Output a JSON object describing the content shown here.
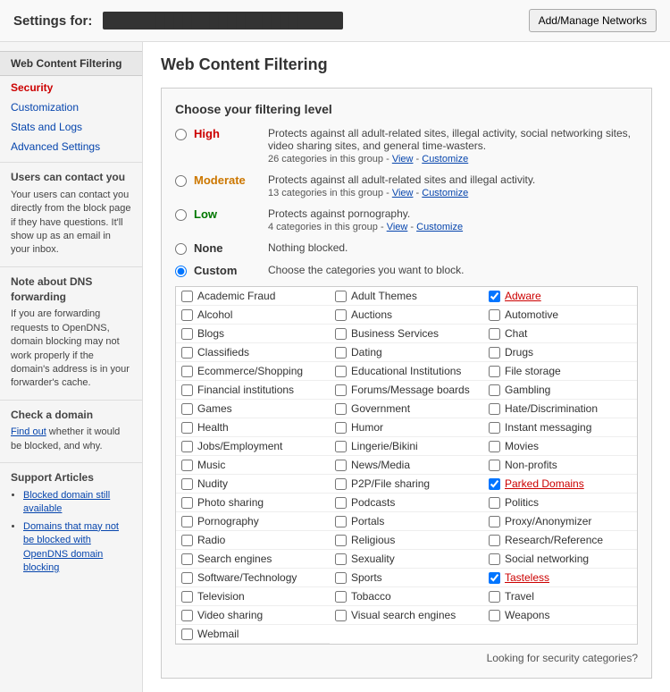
{
  "header": {
    "title": "Settings for:",
    "account": "█████████████████",
    "add_networks_btn": "Add/Manage Networks"
  },
  "sidebar": {
    "section_title": "Web Content Filtering",
    "links": [
      {
        "label": "Security",
        "active": false
      },
      {
        "label": "Customization",
        "active": false
      },
      {
        "label": "Stats and Logs",
        "active": false
      },
      {
        "label": "Advanced Settings",
        "active": false
      }
    ],
    "contact_title": "Users can contact you",
    "contact_text": "Your users can contact you directly from the block page if they have questions. It'll show up as an email in your inbox.",
    "dns_title": "Note about DNS forwarding",
    "dns_text": "If you are forwarding requests to OpenDNS, domain blocking may not work properly if the domain's address is in your forwarder's cache.",
    "check_title": "Check a domain",
    "check_link_text": "Find out",
    "check_text": " whether it would be blocked, and why.",
    "support_title": "Support Articles",
    "support_links": [
      "Blocked domain still available",
      "Domains that may not be blocked with OpenDNS domain blocking"
    ]
  },
  "content": {
    "title": "Web Content Filtering",
    "filter_panel_title": "Choose your filtering level",
    "options": [
      {
        "id": "high",
        "label": "High",
        "color_class": "high",
        "desc": "Protects against all adult-related sites, illegal activity, social networking sites, video sharing sites, and general time-wasters.",
        "sub": "26 categories in this group - View - Customize",
        "checked": false
      },
      {
        "id": "moderate",
        "label": "Moderate",
        "color_class": "moderate",
        "desc": "Protects against all adult-related sites and illegal activity.",
        "sub": "13 categories in this group - View - Customize",
        "checked": false
      },
      {
        "id": "low",
        "label": "Low",
        "color_class": "low",
        "desc": "Protects against pornography.",
        "sub": "4 categories in this group - View - Customize",
        "checked": false
      },
      {
        "id": "none",
        "label": "None",
        "color_class": "",
        "desc": "Nothing blocked.",
        "sub": "",
        "checked": false
      },
      {
        "id": "custom",
        "label": "Custom",
        "color_class": "",
        "desc": "Choose the categories you want to block.",
        "sub": "",
        "checked": true
      }
    ],
    "categories": [
      {
        "label": "Academic Fraud",
        "checked": false,
        "col": 0
      },
      {
        "label": "Adult Themes",
        "checked": false,
        "col": 1
      },
      {
        "label": "Adware",
        "checked": true,
        "col": 2
      },
      {
        "label": "Alcohol",
        "checked": false,
        "col": 0
      },
      {
        "label": "Auctions",
        "checked": false,
        "col": 1
      },
      {
        "label": "Automotive",
        "checked": false,
        "col": 2
      },
      {
        "label": "Blogs",
        "checked": false,
        "col": 0
      },
      {
        "label": "Business Services",
        "checked": false,
        "col": 1
      },
      {
        "label": "Chat",
        "checked": false,
        "col": 2
      },
      {
        "label": "Classifieds",
        "checked": false,
        "col": 0
      },
      {
        "label": "Dating",
        "checked": false,
        "col": 1
      },
      {
        "label": "Drugs",
        "checked": false,
        "col": 2
      },
      {
        "label": "Ecommerce/Shopping",
        "checked": false,
        "col": 0
      },
      {
        "label": "Educational Institutions",
        "checked": false,
        "col": 1
      },
      {
        "label": "File storage",
        "checked": false,
        "col": 2
      },
      {
        "label": "Financial institutions",
        "checked": false,
        "col": 0
      },
      {
        "label": "Forums/Message boards",
        "checked": false,
        "col": 1
      },
      {
        "label": "Gambling",
        "checked": false,
        "col": 2
      },
      {
        "label": "Games",
        "checked": false,
        "col": 0
      },
      {
        "label": "Government",
        "checked": false,
        "col": 1
      },
      {
        "label": "Hate/Discrimination",
        "checked": false,
        "col": 2
      },
      {
        "label": "Health",
        "checked": false,
        "col": 0
      },
      {
        "label": "Humor",
        "checked": false,
        "col": 1
      },
      {
        "label": "Instant messaging",
        "checked": false,
        "col": 2
      },
      {
        "label": "Jobs/Employment",
        "checked": false,
        "col": 0
      },
      {
        "label": "Lingerie/Bikini",
        "checked": false,
        "col": 1
      },
      {
        "label": "Movies",
        "checked": false,
        "col": 2
      },
      {
        "label": "Music",
        "checked": false,
        "col": 0
      },
      {
        "label": "News/Media",
        "checked": false,
        "col": 1
      },
      {
        "label": "Non-profits",
        "checked": false,
        "col": 2
      },
      {
        "label": "Nudity",
        "checked": false,
        "col": 0
      },
      {
        "label": "P2P/File sharing",
        "checked": false,
        "col": 1
      },
      {
        "label": "Parked Domains",
        "checked": true,
        "col": 2
      },
      {
        "label": "Photo sharing",
        "checked": false,
        "col": 0
      },
      {
        "label": "Podcasts",
        "checked": false,
        "col": 1
      },
      {
        "label": "Politics",
        "checked": false,
        "col": 2
      },
      {
        "label": "Pornography",
        "checked": false,
        "col": 0
      },
      {
        "label": "Portals",
        "checked": false,
        "col": 1
      },
      {
        "label": "Proxy/Anonymizer",
        "checked": false,
        "col": 2
      },
      {
        "label": "Radio",
        "checked": false,
        "col": 0
      },
      {
        "label": "Religious",
        "checked": false,
        "col": 1
      },
      {
        "label": "Research/Reference",
        "checked": false,
        "col": 2
      },
      {
        "label": "Search engines",
        "checked": false,
        "col": 0
      },
      {
        "label": "Sexuality",
        "checked": false,
        "col": 1
      },
      {
        "label": "Social networking",
        "checked": false,
        "col": 2
      },
      {
        "label": "Software/Technology",
        "checked": false,
        "col": 0
      },
      {
        "label": "Sports",
        "checked": false,
        "col": 1
      },
      {
        "label": "Tasteless",
        "checked": true,
        "col": 2
      },
      {
        "label": "Television",
        "checked": false,
        "col": 0
      },
      {
        "label": "Tobacco",
        "checked": false,
        "col": 1
      },
      {
        "label": "Travel",
        "checked": false,
        "col": 2
      },
      {
        "label": "Video sharing",
        "checked": false,
        "col": 0
      },
      {
        "label": "Visual search engines",
        "checked": false,
        "col": 1
      },
      {
        "label": "Weapons",
        "checked": false,
        "col": 2
      },
      {
        "label": "Webmail",
        "checked": false,
        "col": 0
      }
    ],
    "bottom_note": "Looking for security categories?"
  }
}
